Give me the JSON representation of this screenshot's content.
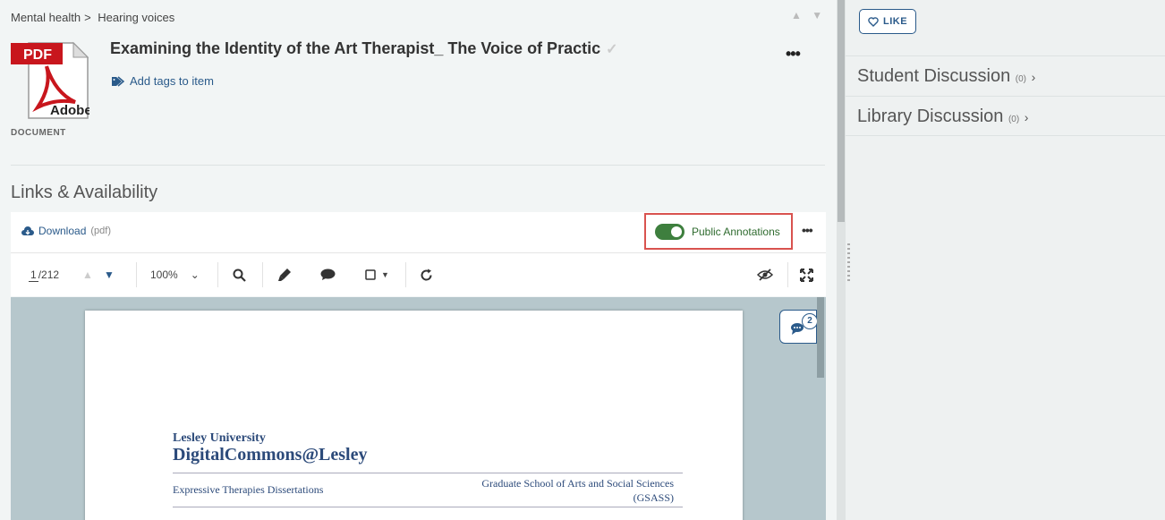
{
  "breadcrumb": {
    "item1": "Mental health",
    "sep": ">",
    "item2": "Hearing voices"
  },
  "item": {
    "title": "Examining the Identity of the Art Therapist_ The Voice of Practic",
    "doc_type": "DOCUMENT",
    "pdf_badge": "PDF",
    "pdf_brand": "Adobe",
    "tags_label": "Add tags to item"
  },
  "links_heading": "Links & Availability",
  "viewer_toolbar": {
    "download_label": "Download",
    "download_format": "(pdf)",
    "annotations_label": "Public Annotations",
    "annotations_on": true,
    "page_current": "1",
    "page_total": "/212",
    "zoom": "100%",
    "comment_count": "2"
  },
  "document_page": {
    "university": "Lesley University",
    "repository": "DigitalCommons@Lesley",
    "collection": "Expressive Therapies Dissertations",
    "school_line1": "Graduate School of Arts and Social Sciences",
    "school_line2": "(GSASS)"
  },
  "sidebar": {
    "like_label": "LIKE",
    "discussions": [
      {
        "title": "Student Discussion",
        "count": "(0)"
      },
      {
        "title": "Library Discussion",
        "count": "(0)"
      }
    ]
  },
  "colors": {
    "accent": "#2a5a8a",
    "toggle_on": "#3e7f3e",
    "highlight_border": "#d9534f",
    "viewer_bg": "#b6c7cc"
  }
}
